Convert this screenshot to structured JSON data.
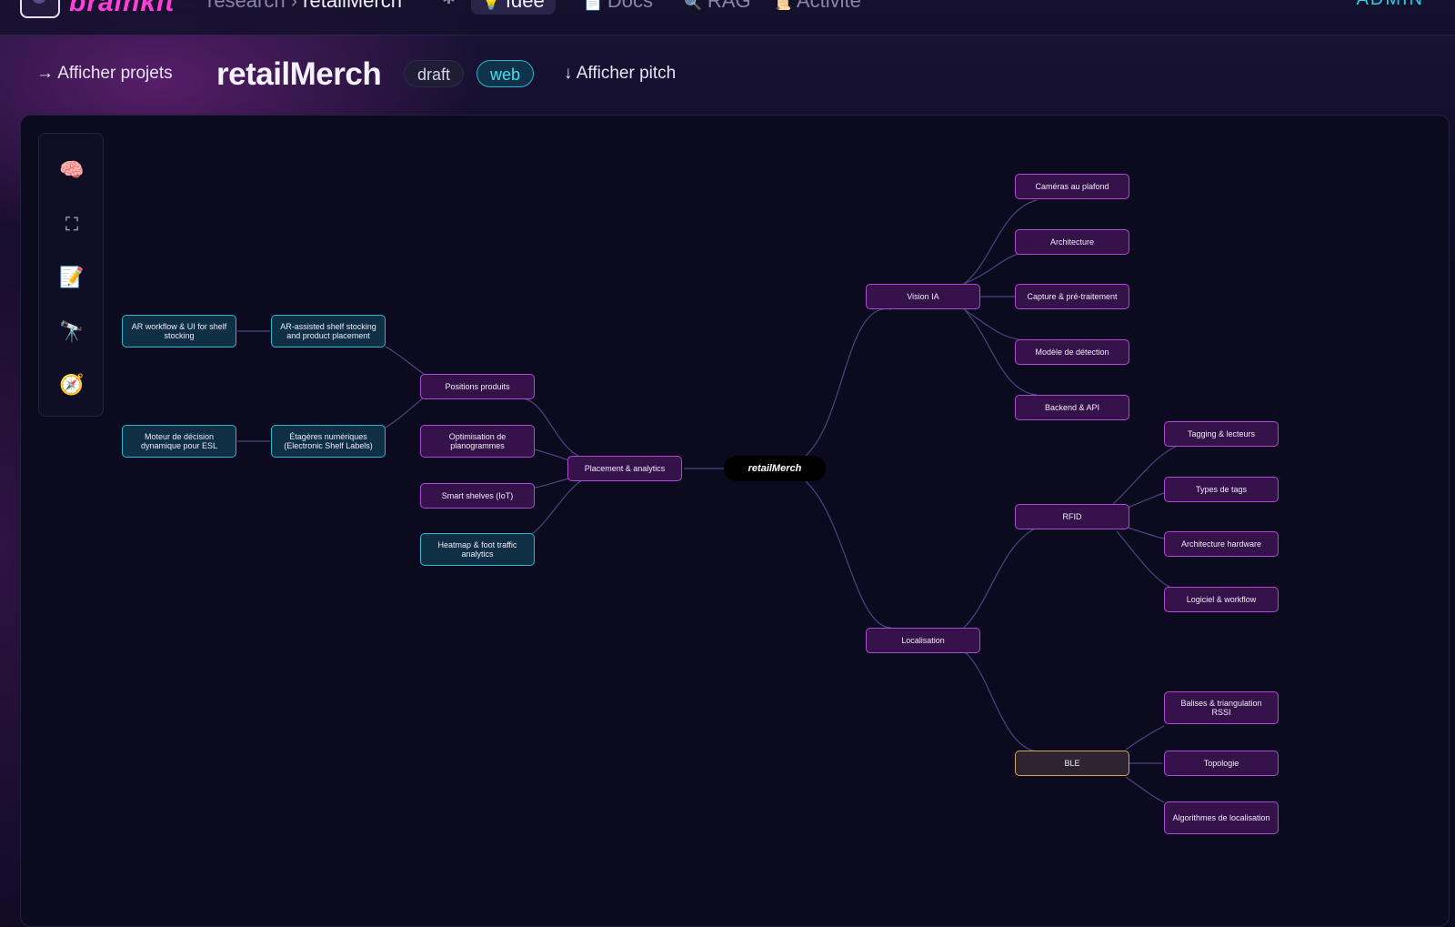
{
  "topbar": {
    "brand": "brainkit",
    "breadcrumb_parent": "research",
    "breadcrumb_sep": "›",
    "breadcrumb_current": "retailMerch",
    "star_icon": "✱",
    "tabs": [
      {
        "label": "Idée",
        "icon": "💡",
        "active": true
      },
      {
        "label": "Docs",
        "icon": "📄",
        "active": false
      },
      {
        "label": "RAG",
        "icon": "🔍",
        "active": false
      },
      {
        "label": "Activité",
        "icon": "📜",
        "active": false
      }
    ],
    "admin": "ADMIN"
  },
  "header": {
    "show_projects": "→ Afficher projets",
    "title": "retailMerch",
    "tags": [
      "draft",
      "web"
    ],
    "show_pitch": "↓ Afficher pitch"
  },
  "toolbar": {
    "tools": [
      "brain-icon",
      "fullscreen-icon",
      "memo-icon",
      "telescope-icon",
      "compass-icon"
    ]
  },
  "colors": {
    "accent_pink": "#b04ad6",
    "accent_teal": "#29b8d4",
    "accent_gold": "#d6a85a",
    "brand": "#ff3fd8"
  },
  "mindmap": {
    "root": "retailMerch",
    "nodes": {
      "placement": "Placement & analytics",
      "positions": "Positions produits",
      "optimisation": "Optimisation de planogrammes",
      "smart_shelves": "Smart shelves (IoT)",
      "heatmap": "Heatmap & foot traffic analytics",
      "ar_assisted": "AR-assisted shelf stocking and product placement",
      "ar_workflow": "AR workflow & UI for shelf stocking",
      "etageres": "Étagères numériques (Electronic Shelf Labels)",
      "moteur": "Moteur de décision dynamique pour ESL",
      "vision": "Vision IA",
      "cameras": "Caméras au plafond",
      "architecture": "Architecture",
      "capture": "Capture & pré-traitement",
      "modele": "Modèle de détection",
      "backend": "Backend & API",
      "localisation": "Localisation",
      "rfid": "RFID",
      "tagging": "Tagging & lecteurs",
      "types_tags": "Types de tags",
      "arch_hw": "Architecture hardware",
      "logiciel": "Logiciel & workflow",
      "ble": "BLE",
      "balises": "Balises & triangulation RSSI",
      "topologie": "Topologie",
      "algorithmes": "Algorithmes de localisation"
    }
  }
}
